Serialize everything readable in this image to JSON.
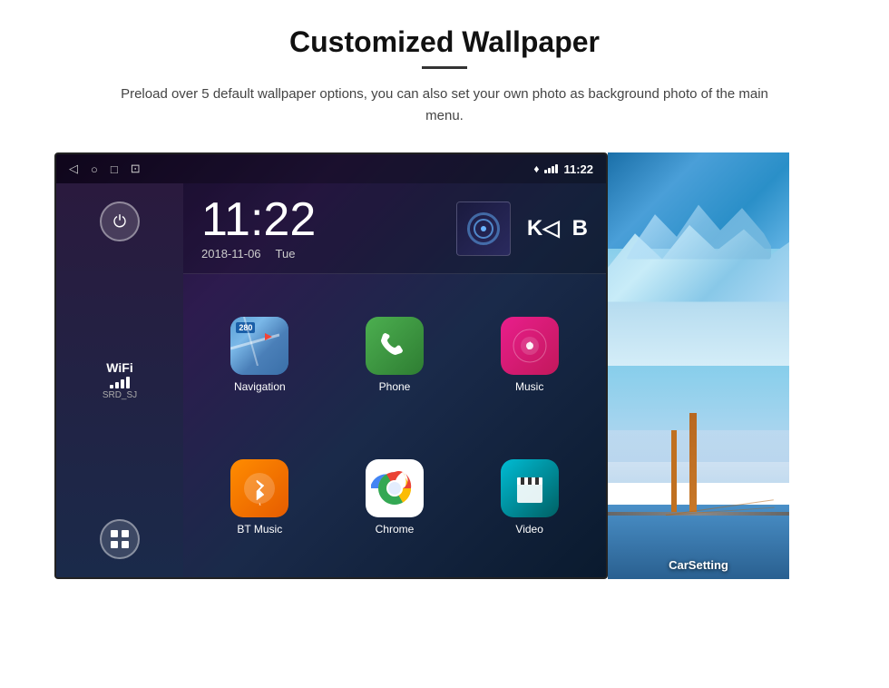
{
  "header": {
    "title": "Customized Wallpaper",
    "description": "Preload over 5 default wallpaper options, you can also set your own photo as background photo of the main menu."
  },
  "device": {
    "status_bar": {
      "time": "11:22",
      "icons": [
        "back",
        "home",
        "recent",
        "screenshot"
      ]
    },
    "clock": {
      "time": "11:22",
      "date": "2018-11-06",
      "day": "Tue"
    },
    "sidebar": {
      "wifi_label": "WiFi",
      "wifi_ssid": "SRD_SJ"
    },
    "apps": [
      {
        "label": "Navigation",
        "icon": "navigation"
      },
      {
        "label": "Phone",
        "icon": "phone"
      },
      {
        "label": "Music",
        "icon": "music"
      },
      {
        "label": "BT Music",
        "icon": "bt-music"
      },
      {
        "label": "Chrome",
        "icon": "chrome"
      },
      {
        "label": "Video",
        "icon": "video"
      }
    ]
  },
  "wallpapers": [
    {
      "name": "glacier",
      "label": ""
    },
    {
      "name": "bridge",
      "label": "CarSetting"
    }
  ]
}
